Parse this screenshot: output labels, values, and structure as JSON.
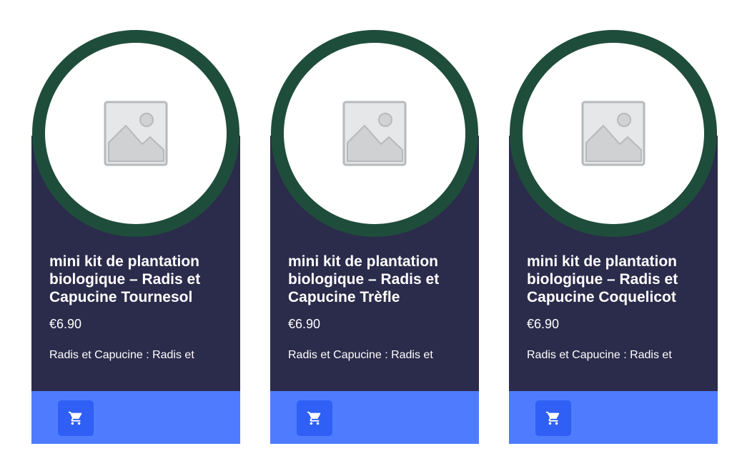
{
  "colors": {
    "card_body": "#2b2b4b",
    "ring": "#1f4d3b",
    "footer": "#4f7cff",
    "cart_button": "#2f5ff5",
    "text": "#ffffff"
  },
  "products": [
    {
      "image_icon": "image-placeholder-icon",
      "title": "mini kit de plantation biologique – Radis et Capucine Tournesol",
      "price": "€6.90",
      "excerpt": "Radis et Capucine : Radis et",
      "cart_icon": "cart-icon"
    },
    {
      "image_icon": "image-placeholder-icon",
      "title": "mini kit de plantation biologique – Radis et Capucine Trèfle",
      "price": "€6.90",
      "excerpt": "Radis et Capucine : Radis et",
      "cart_icon": "cart-icon"
    },
    {
      "image_icon": "image-placeholder-icon",
      "title": "mini kit de plantation biologique – Radis et Capucine Coquelicot",
      "price": "€6.90",
      "excerpt": "Radis et Capucine : Radis et",
      "cart_icon": "cart-icon"
    }
  ]
}
